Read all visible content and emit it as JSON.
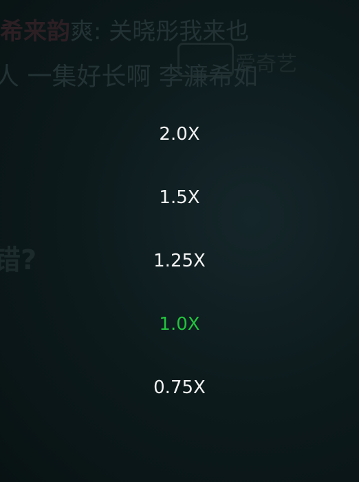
{
  "background": {
    "subtitle_line1_bold": "希来韵",
    "subtitle_line1_rest": "爽: 关晓彤我来也",
    "subtitle_line2": "人    一集好长啊    李濂希如",
    "watermark": "爱奇艺",
    "question_text": "错?"
  },
  "speed_menu": {
    "options": [
      {
        "label": "2.0X"
      },
      {
        "label": "1.5X"
      },
      {
        "label": "1.25X"
      },
      {
        "label": "1.0X"
      },
      {
        "label": "0.75X"
      }
    ],
    "selected_label": "1.0X"
  },
  "colors": {
    "selected": "#23c33e",
    "normal": "#f2f2f2",
    "background": "#0b1617"
  }
}
